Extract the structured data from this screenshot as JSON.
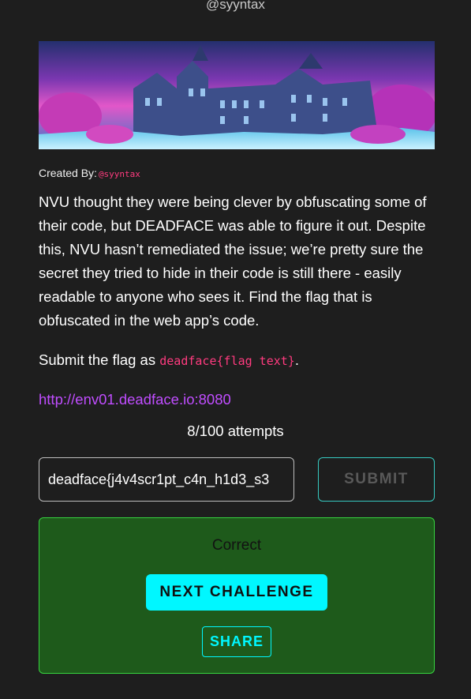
{
  "header": {
    "author_handle": "@syyntax"
  },
  "challenge": {
    "created_by_label": "Created By:",
    "created_by_handle": "@syyntax",
    "description": "NVU thought they were being clever by obfuscating some of their code, but DEADFACE was able to figure it out. Despite this, NVU hasn’t remediated the issue; we’re pretty sure the secret they tried to hide in their code is still there - easily readable to anyone who sees it. Find the flag that is obfuscated in the web app’s code.",
    "submit_prefix": "Submit the flag as ",
    "flag_format": "deadface{flag text}",
    "submit_suffix": ".",
    "link": "http://env01.deadface.io:8080",
    "attempts": "8/100 attempts"
  },
  "form": {
    "flag_value": "deadface{j4v4scr1pt_c4n_h1d3_s3",
    "submit_label": "SUBMIT"
  },
  "result": {
    "status_text": "Correct",
    "next_label": "NEXT CHALLENGE",
    "share_label": "SHARE"
  },
  "colors": {
    "background": "#1e1e1e",
    "accent_cyan": "#00f7ff",
    "success_panel": "#1e5a1b",
    "success_border": "#36d43f",
    "handle_pink": "#ff3b7f",
    "link_purple": "#c04dff"
  }
}
